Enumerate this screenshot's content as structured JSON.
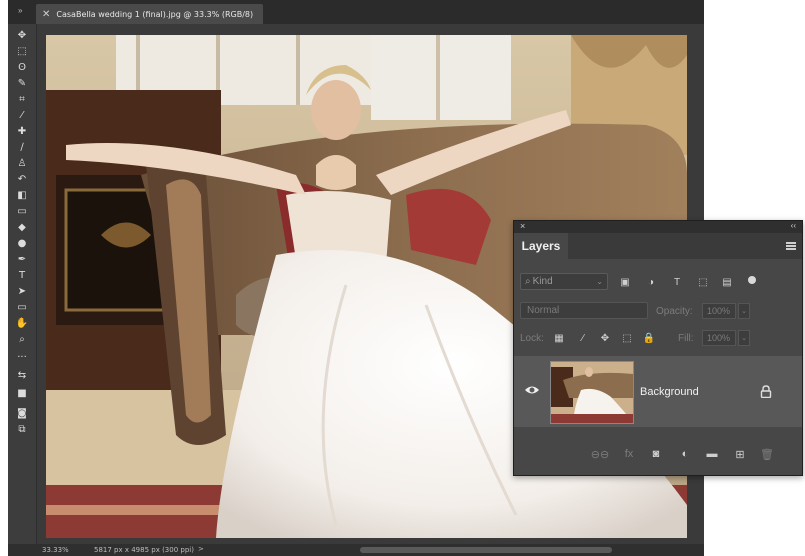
{
  "window": {
    "document_tab_title": "CasaBella wedding 1 (final).jpg @ 33.3% (RGB/8)",
    "panel_collapse_glyph": "»"
  },
  "toolbar": {
    "tools": [
      {
        "name": "move-tool-icon",
        "glyph": "✥"
      },
      {
        "name": "marquee-tool-icon",
        "glyph": "⬚"
      },
      {
        "name": "lasso-tool-icon",
        "glyph": "ʘ"
      },
      {
        "name": "quick-selection-tool-icon",
        "glyph": "✎"
      },
      {
        "name": "crop-tool-icon",
        "glyph": "⌗"
      },
      {
        "name": "eyedropper-tool-icon",
        "glyph": "⁄"
      },
      {
        "name": "healing-brush-tool-icon",
        "glyph": "✚"
      },
      {
        "name": "brush-tool-icon",
        "glyph": "∕"
      },
      {
        "name": "clone-stamp-tool-icon",
        "glyph": "♙"
      },
      {
        "name": "history-brush-tool-icon",
        "glyph": "↶"
      },
      {
        "name": "eraser-tool-icon",
        "glyph": "◧"
      },
      {
        "name": "gradient-tool-icon",
        "glyph": "▭"
      },
      {
        "name": "blur-tool-icon",
        "glyph": "◆"
      },
      {
        "name": "dodge-tool-icon",
        "glyph": "●"
      },
      {
        "name": "pen-tool-icon",
        "glyph": "✒"
      },
      {
        "name": "type-tool-icon",
        "glyph": "T"
      },
      {
        "name": "path-selection-tool-icon",
        "glyph": "➤"
      },
      {
        "name": "shape-tool-icon",
        "glyph": "▭"
      },
      {
        "name": "hand-tool-icon",
        "glyph": "✋"
      },
      {
        "name": "zoom-tool-icon",
        "glyph": "⌕"
      },
      {
        "name": "more-tools-icon",
        "glyph": "···"
      },
      {
        "name": "swap-colors-icon",
        "glyph": "⇆"
      },
      {
        "name": "color-swatches-icon",
        "glyph": "■"
      },
      {
        "name": "quick-mask-icon",
        "glyph": "◙"
      },
      {
        "name": "screen-mode-icon",
        "glyph": "⧉"
      }
    ]
  },
  "status_bar": {
    "zoom": "33.33%",
    "dimensions": "5817 px x 4985 px (300 ppi)",
    "arrow": ">"
  },
  "layers_panel": {
    "close_glyph": "×",
    "collapse_glyph": "‹‹",
    "tab_label": "Layers",
    "filter_kind": "Kind",
    "filter_icons": [
      {
        "name": "pixel-layer-filter-icon",
        "glyph": "▣"
      },
      {
        "name": "adjustment-layer-filter-icon",
        "glyph": "◑"
      },
      {
        "name": "type-layer-filter-icon",
        "glyph": "T"
      },
      {
        "name": "shape-layer-filter-icon",
        "glyph": "⬚"
      },
      {
        "name": "smart-object-filter-icon",
        "glyph": "▤"
      }
    ],
    "blend_mode": "Normal",
    "opacity_label": "Opacity:",
    "opacity_value": "100%",
    "lock_label": "Lock:",
    "lock_icons": [
      {
        "name": "lock-transparent-pixels-icon",
        "glyph": "▦"
      },
      {
        "name": "lock-image-pixels-icon",
        "glyph": "∕"
      },
      {
        "name": "lock-position-icon",
        "glyph": "✥"
      },
      {
        "name": "lock-artboard-icon",
        "glyph": "⬚"
      },
      {
        "name": "lock-all-icon",
        "glyph": "🔒"
      }
    ],
    "fill_label": "Fill:",
    "fill_value": "100%",
    "dropdown_glyph": "⌄",
    "layers": [
      {
        "name": "Background",
        "visible": true,
        "locked": true
      }
    ],
    "footer_icons": [
      {
        "name": "link-layers-icon",
        "glyph": "⊖⊖",
        "dim": true
      },
      {
        "name": "layer-style-fx-icon",
        "glyph": "fx",
        "dim": true
      },
      {
        "name": "add-mask-icon",
        "glyph": "◙",
        "dim": false
      },
      {
        "name": "adjustment-layer-icon",
        "glyph": "◐",
        "dim": false
      },
      {
        "name": "new-group-folder-icon",
        "glyph": "▬",
        "dim": false
      },
      {
        "name": "new-layer-icon",
        "glyph": "⊞",
        "dim": false
      },
      {
        "name": "delete-layer-trash-icon",
        "glyph": "🗑",
        "dim": true
      }
    ]
  }
}
